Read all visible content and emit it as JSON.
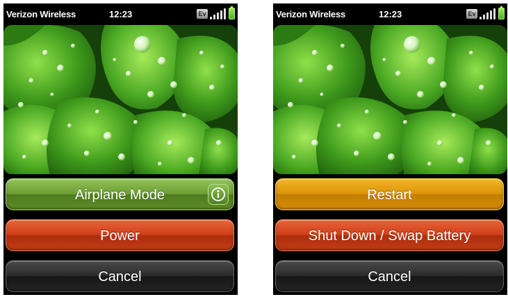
{
  "left_screen": {
    "status": {
      "carrier": "Verizon Wireless",
      "time": "12:23",
      "network": "Ev"
    },
    "buttons": {
      "airplane_mode": "Airplane Mode",
      "power": "Power",
      "cancel": "Cancel"
    },
    "icons": {
      "info": "info-icon"
    }
  },
  "right_screen": {
    "status": {
      "carrier": "Verizon Wireless",
      "time": "12:23",
      "network": "Ev"
    },
    "buttons": {
      "restart": "Restart",
      "shutdown": "Shut Down / Swap Battery",
      "cancel": "Cancel"
    }
  },
  "colors": {
    "airplane_green": "#6d9d33",
    "power_red": "#cf3f19",
    "restart_orange": "#dc9408",
    "cancel_dark": "#2c2c2c",
    "battery_green": "#43b21c"
  }
}
